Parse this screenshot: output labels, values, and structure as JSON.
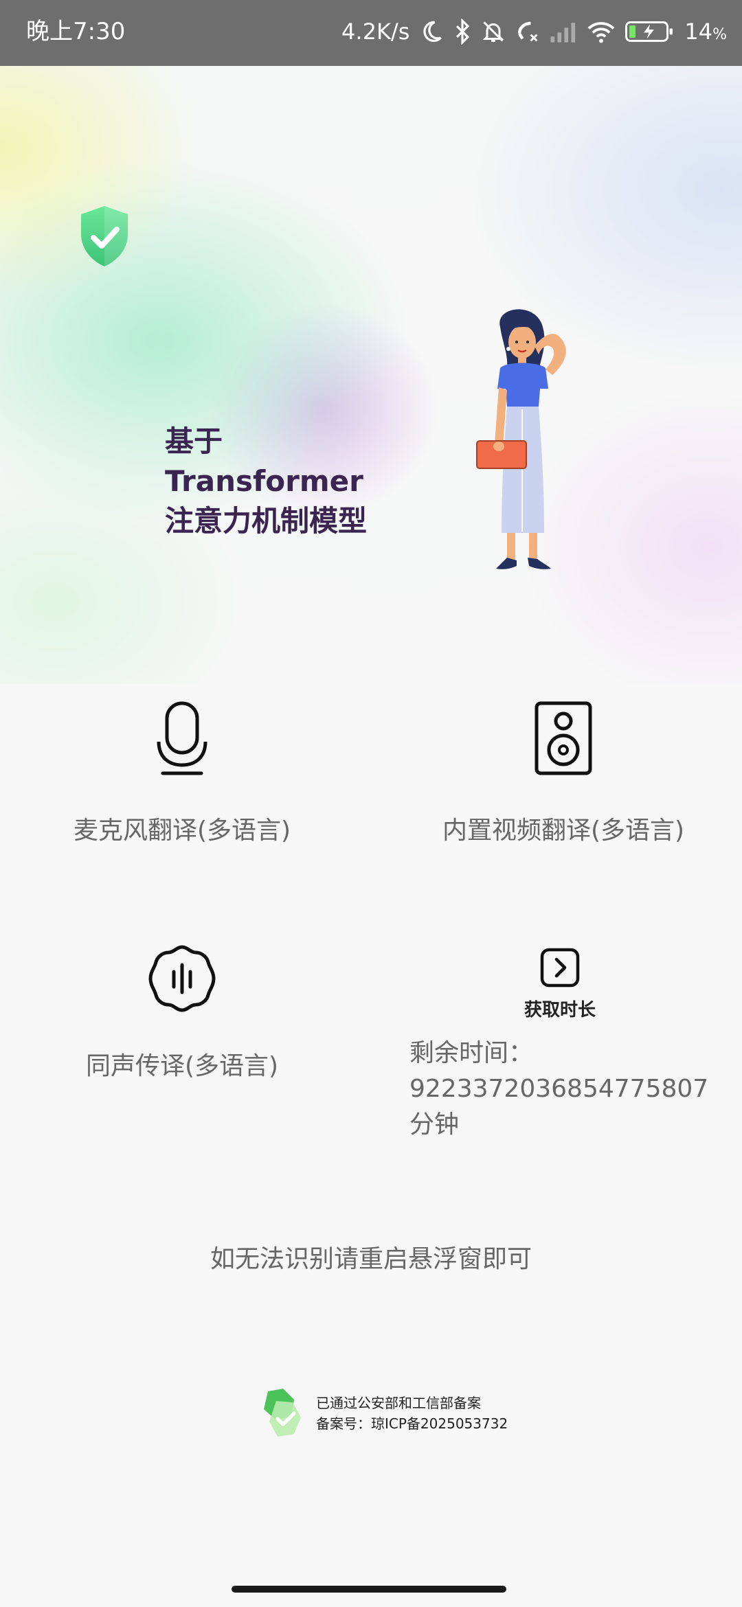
{
  "status_bar": {
    "time": "晚上7:30",
    "net_speed": "4.2K/s",
    "battery": "14",
    "battery_unit": "%",
    "battery_level": 0.14,
    "icons": [
      "moon-icon",
      "bluetooth-icon",
      "bell-muted-icon",
      "call-forward-icon",
      "signal-icon",
      "wifi-icon",
      "battery-charging-icon"
    ]
  },
  "hero": {
    "title_lines": [
      "基于",
      "Transformer",
      "注意力机制模型"
    ],
    "icons": [
      "shield-check-icon",
      "woman-illustration"
    ]
  },
  "features": [
    {
      "label": "麦克风翻译(多语言)",
      "icon": "microphone-icon"
    },
    {
      "label": "内置视频翻译(多语言)",
      "icon": "speaker-icon"
    },
    {
      "label": "同声传译(多语言)",
      "icon": "soundwave-badge-icon"
    }
  ],
  "get_time": {
    "label": "获取时长",
    "icon": "play-square-icon"
  },
  "remaining": {
    "label": "剩余时间：",
    "value": "9223372036854775807",
    "unit": "分钟"
  },
  "hint": "如无法识别请重启悬浮窗即可",
  "filing": {
    "line1": "已通过公安部和工信部备案",
    "line2": "备案号：琼ICP备2025053732",
    "icon": "verified-badge-icon"
  },
  "colors": {
    "status_bar_bg": "#6e6e6e",
    "title_color": "#3a2550",
    "shield_green": "#5ad68a",
    "label_gray": "#666666"
  }
}
